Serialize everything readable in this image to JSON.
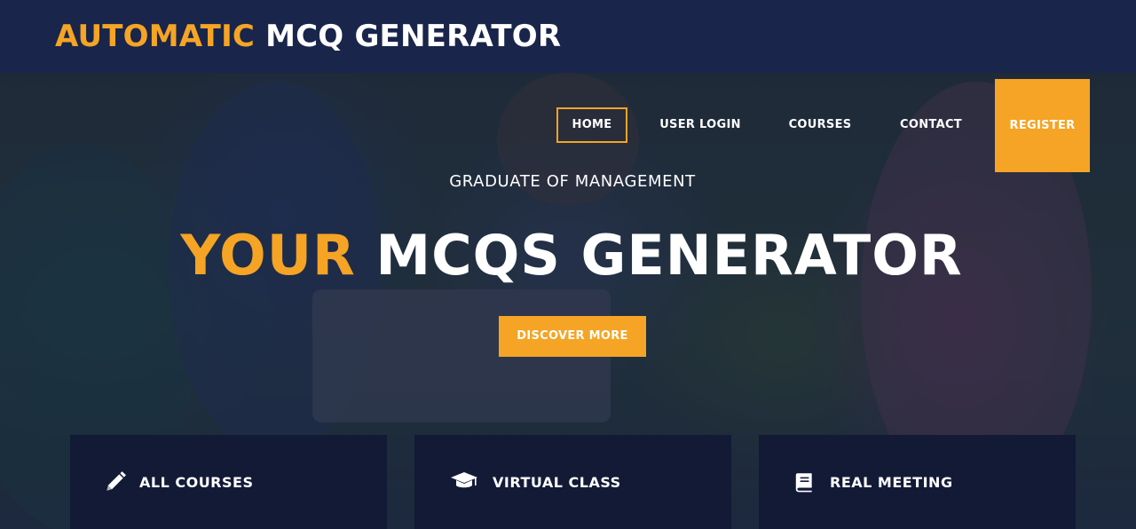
{
  "header": {
    "logo_accent": "AUTOMATIC",
    "logo_plain": "MCQ GENERATOR"
  },
  "nav": {
    "home": "HOME",
    "user_login": "USER LOGIN",
    "courses": "COURSES",
    "contact": "CONTACT",
    "register": "REGISTER",
    "active": "HOME"
  },
  "hero": {
    "subtitle": "GRADUATE OF MANAGEMENT",
    "headline_accent": "YOUR",
    "headline_plain": "MCQS GENERATOR",
    "cta_label": "DISCOVER MORE"
  },
  "features": [
    {
      "icon": "pencil-icon",
      "label": "ALL COURSES"
    },
    {
      "icon": "graduation-cap-icon",
      "label": "VIRTUAL CLASS"
    },
    {
      "icon": "book-icon",
      "label": "REAL MEETING"
    }
  ],
  "colors": {
    "accent": "#f5a425",
    "navy": "#19254a",
    "card": "#121a36"
  }
}
